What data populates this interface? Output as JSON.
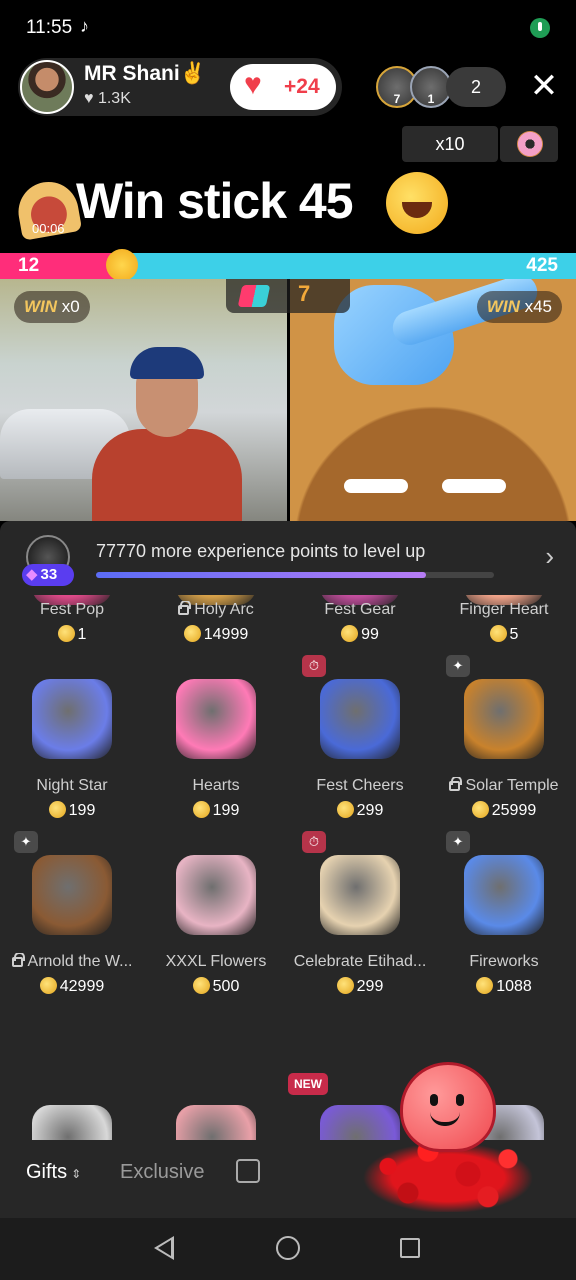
{
  "status": {
    "time": "11:55",
    "tiktok_glyph": "♪"
  },
  "host": {
    "name": "MR Shani✌️",
    "likes": "♥ 1.3K",
    "follow_plus": "+24"
  },
  "viewers": {
    "badges": [
      "7",
      "1"
    ],
    "count": "2"
  },
  "multiplier": {
    "label": "x10"
  },
  "stream": {
    "title": "Win stick 45",
    "timer": "00:06"
  },
  "battle": {
    "left_score": "12",
    "right_score": "425",
    "left_fraction": 0.22,
    "center_badge": "7",
    "left_win_word": "WIN",
    "left_win_mult": "x0",
    "right_win_word": "WIN",
    "right_win_mult": "x45"
  },
  "level": {
    "number": "33",
    "text": "77770 more experience points to level up",
    "progress": 0.83
  },
  "gifts": [
    {
      "name": "Fest Pop",
      "price": "1",
      "locked": false,
      "color": "#e04a8a"
    },
    {
      "name": "Holy Arc",
      "price": "14999",
      "locked": true,
      "color": "#d8a24a"
    },
    {
      "name": "Fest Gear",
      "price": "99",
      "locked": false,
      "color": "#c44e9e"
    },
    {
      "name": "Finger Heart",
      "price": "5",
      "locked": false,
      "color": "#f2a48a"
    },
    {
      "name": "Night Star",
      "price": "199",
      "locked": false,
      "color": "#6b7de8"
    },
    {
      "name": "Hearts",
      "price": "199",
      "locked": false,
      "color": "#ff7ab6"
    },
    {
      "name": "Fest Cheers",
      "price": "299",
      "locked": false,
      "color": "#4a6ad8"
    },
    {
      "name": "Solar Temple",
      "price": "25999",
      "locked": true,
      "color": "#c9822c"
    },
    {
      "name": "Arnold the W...",
      "price": "42999",
      "locked": true,
      "color": "#8a5a34"
    },
    {
      "name": "XXXL Flowers",
      "price": "500",
      "locked": false,
      "color": "#e8b4c4"
    },
    {
      "name": "Celebrate Etihad...",
      "price": "299",
      "locked": false,
      "color": "#e6d2b0"
    },
    {
      "name": "Fireworks",
      "price": "1088",
      "locked": false,
      "color": "#5a8ae8"
    }
  ],
  "tags": {
    "new": "NEW"
  },
  "tabs": {
    "gifts": "Gifts",
    "exclusive": "Exclusive"
  }
}
